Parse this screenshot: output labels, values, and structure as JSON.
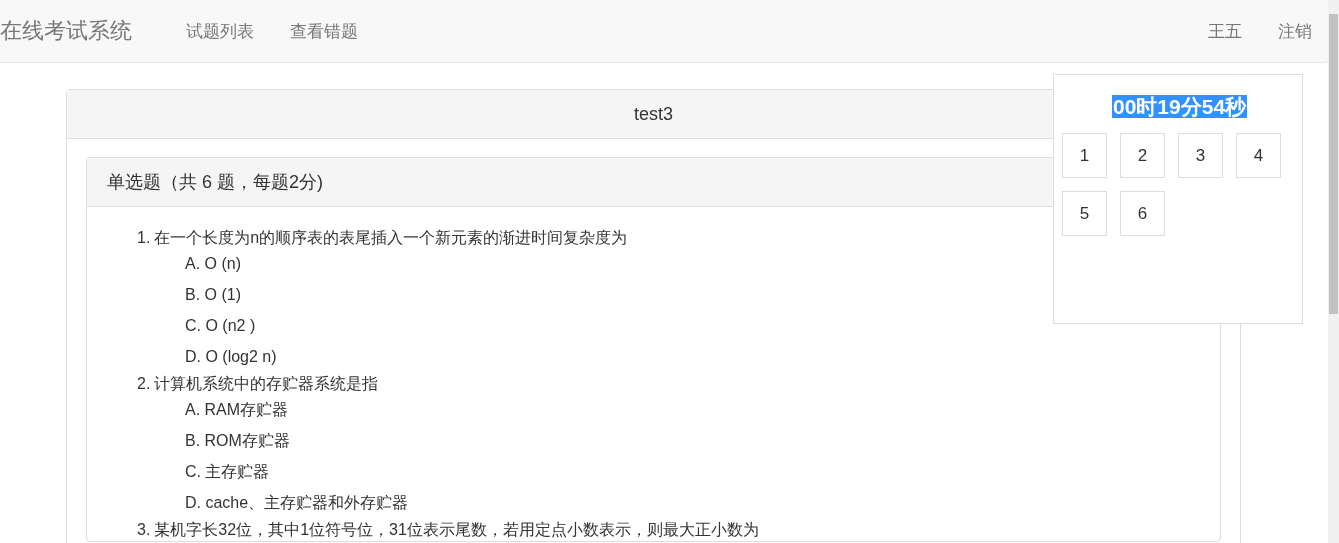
{
  "navbar": {
    "brand": "在线考试系统",
    "links": [
      {
        "label": "试题列表"
      },
      {
        "label": "查看错题"
      }
    ],
    "user": "王五",
    "logout": "注销"
  },
  "paper": {
    "title": "test3",
    "section": {
      "heading": "单选题（共 6 题，每题2分)",
      "questions": [
        {
          "number": "1.",
          "text": "在一个长度为n的顺序表的表尾插入一个新元素的渐进时间复杂度为",
          "options": [
            "A. O (n)",
            "B. O (1)",
            "C. O (n2 )",
            "D. O (log2 n)"
          ]
        },
        {
          "number": "2.",
          "text": "计算机系统中的存贮器系统是指",
          "options": [
            "A. RAM存贮器",
            "B. ROM存贮器",
            "C. 主存贮器",
            "D. cache、主存贮器和外存贮器"
          ]
        },
        {
          "number": "3.",
          "text": "某机字长32位，其中1位符号位，31位表示尾数，若用定点小数表示，则最大正小数为"
        }
      ]
    }
  },
  "timer": {
    "time": "00时19分54秒",
    "question_buttons": [
      "1",
      "2",
      "3",
      "4",
      "5",
      "6"
    ]
  }
}
